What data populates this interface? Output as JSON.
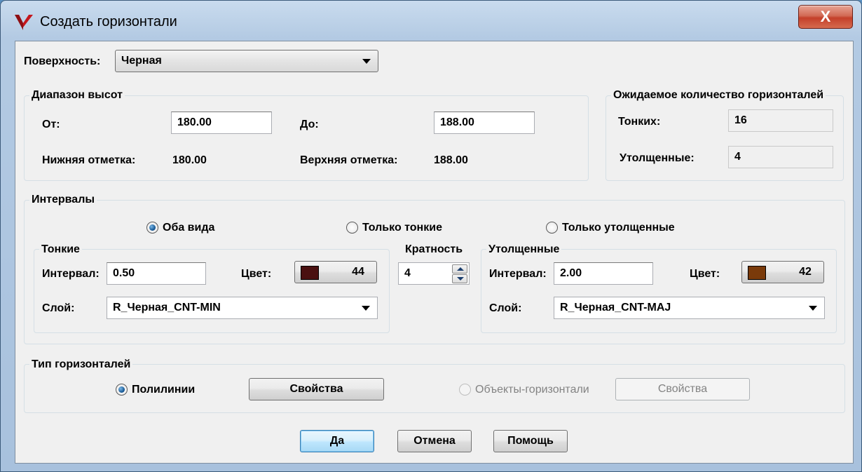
{
  "window": {
    "title": "Создать горизонтали",
    "close_label": "X"
  },
  "surface": {
    "label": "Поверхность:",
    "value": "Черная"
  },
  "height_range": {
    "legend": "Диапазон высот",
    "from_label": "От:",
    "from_value": "180.00",
    "to_label": "До:",
    "to_value": "188.00",
    "lower_label": "Нижняя отметка:",
    "lower_value": "180.00",
    "upper_label": "Верхняя отметка:",
    "upper_value": "188.00"
  },
  "expected": {
    "legend": "Ожидаемое количество горизонталей",
    "thin_label": "Тонких:",
    "thin_value": "16",
    "thick_label": "Утолщенные:",
    "thick_value": "4"
  },
  "intervals": {
    "legend": "Интервалы",
    "radio_both": "Оба вида",
    "radio_thin": "Только тонкие",
    "radio_thick": "Только утолщенные",
    "selected": "both",
    "thin": {
      "legend": "Тонкие",
      "interval_label": "Интервал:",
      "interval_value": "0.50",
      "color_label": "Цвет:",
      "color_number": "44",
      "color_hex": "#4a1010",
      "layer_label": "Слой:",
      "layer_value": "R_Черная_CNT-MIN"
    },
    "multiplicity": {
      "label": "Кратность",
      "value": "4"
    },
    "thick": {
      "legend": "Утолщенные",
      "interval_label": "Интервал:",
      "interval_value": "2.00",
      "color_label": "Цвет:",
      "color_number": "42",
      "color_hex": "#7a3a0a",
      "layer_label": "Слой:",
      "layer_value": "R_Черная_CNT-MAJ"
    }
  },
  "contour_type": {
    "legend": "Тип горизонталей",
    "polylines_label": "Полилинии",
    "polylines_props": "Свойства",
    "objects_label": "Объекты-горизонтали",
    "objects_props": "Свойства",
    "selected": "polylines"
  },
  "buttons": {
    "ok": "Да",
    "cancel": "Отмена",
    "help": "Помощь"
  }
}
